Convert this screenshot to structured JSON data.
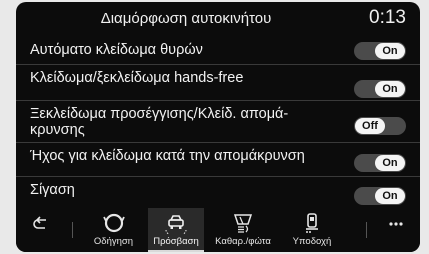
{
  "header": {
    "title": "Διαμόρφωση αυτοκινήτου",
    "clock": "0:13"
  },
  "settings": [
    {
      "label": "Αυτόματο κλείδωμα θυρών",
      "label2": "",
      "state": "On"
    },
    {
      "label": "Κλείδωμα/ξεκλείδωμα hands-free",
      "label2": "",
      "state": "On"
    },
    {
      "label": "Ξεκλείδωμα προσέγγισης/Κλείδ. απομά-",
      "label2": "κρυνσης",
      "state": "Off"
    },
    {
      "label": "Ήχος για κλείδωμα κατά την απομάκρυνση",
      "label2": "",
      "state": "On"
    },
    {
      "label": "Σίγαση",
      "label2": "",
      "state": "On"
    }
  ],
  "nav": {
    "tabs": [
      {
        "label": "Οδήγηση",
        "icon": "drive-mode-icon"
      },
      {
        "label": "Πρόσβαση",
        "icon": "car-access-icon"
      },
      {
        "label": "Καθαρ./φώτα",
        "icon": "wiper-lights-icon"
      },
      {
        "label": "Υποδοχή",
        "icon": "welcome-seat-icon"
      }
    ],
    "back_icon": "back-arrow-icon",
    "more_icon": "more-dots-icon",
    "active_tab": "Πρόσβαση"
  },
  "colors": {
    "screen_bg": "#0c0c0c",
    "toggle_track": "#4b4b4b",
    "toggle_knob": "#f4f4f4",
    "active_tab_bg": "#2a2a2a"
  }
}
